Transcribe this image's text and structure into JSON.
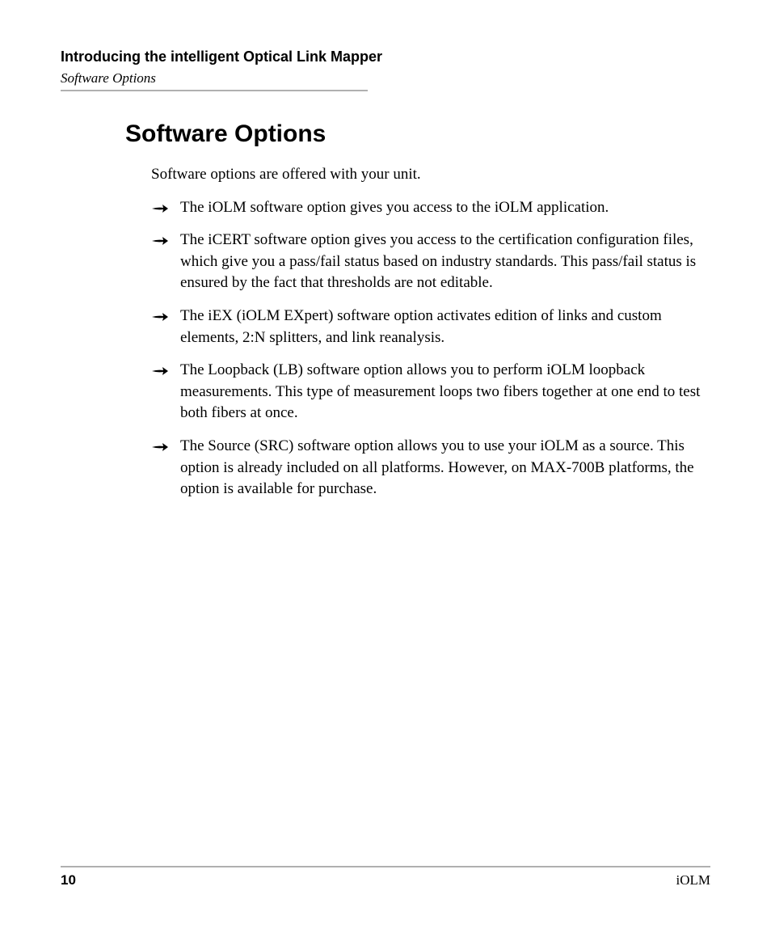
{
  "header": {
    "chapter_title": "Introducing the intelligent Optical Link Mapper",
    "section_name": "Software Options"
  },
  "content": {
    "heading": "Software Options",
    "intro": "Software options are offered with your unit.",
    "bullets": [
      "The iOLM software option gives you access to the iOLM application.",
      "The iCERT software option gives you access to the certification configuration files, which give you a pass/fail status based on industry standards. This pass/fail status is ensured by the fact that thresholds are not editable.",
      "The iEX (iOLM EXpert) software option activates edition of links and custom elements, 2:N splitters, and link reanalysis.",
      "The Loopback (LB) software option allows you to perform iOLM loopback measurements. This type of measurement loops two fibers together at one end to test both fibers at once.",
      "The Source (SRC) software option allows you to use your iOLM as a source. This option is already included on all platforms. However, on MAX-700B platforms, the option is available for purchase."
    ]
  },
  "footer": {
    "page_number": "10",
    "label": "iOLM"
  }
}
